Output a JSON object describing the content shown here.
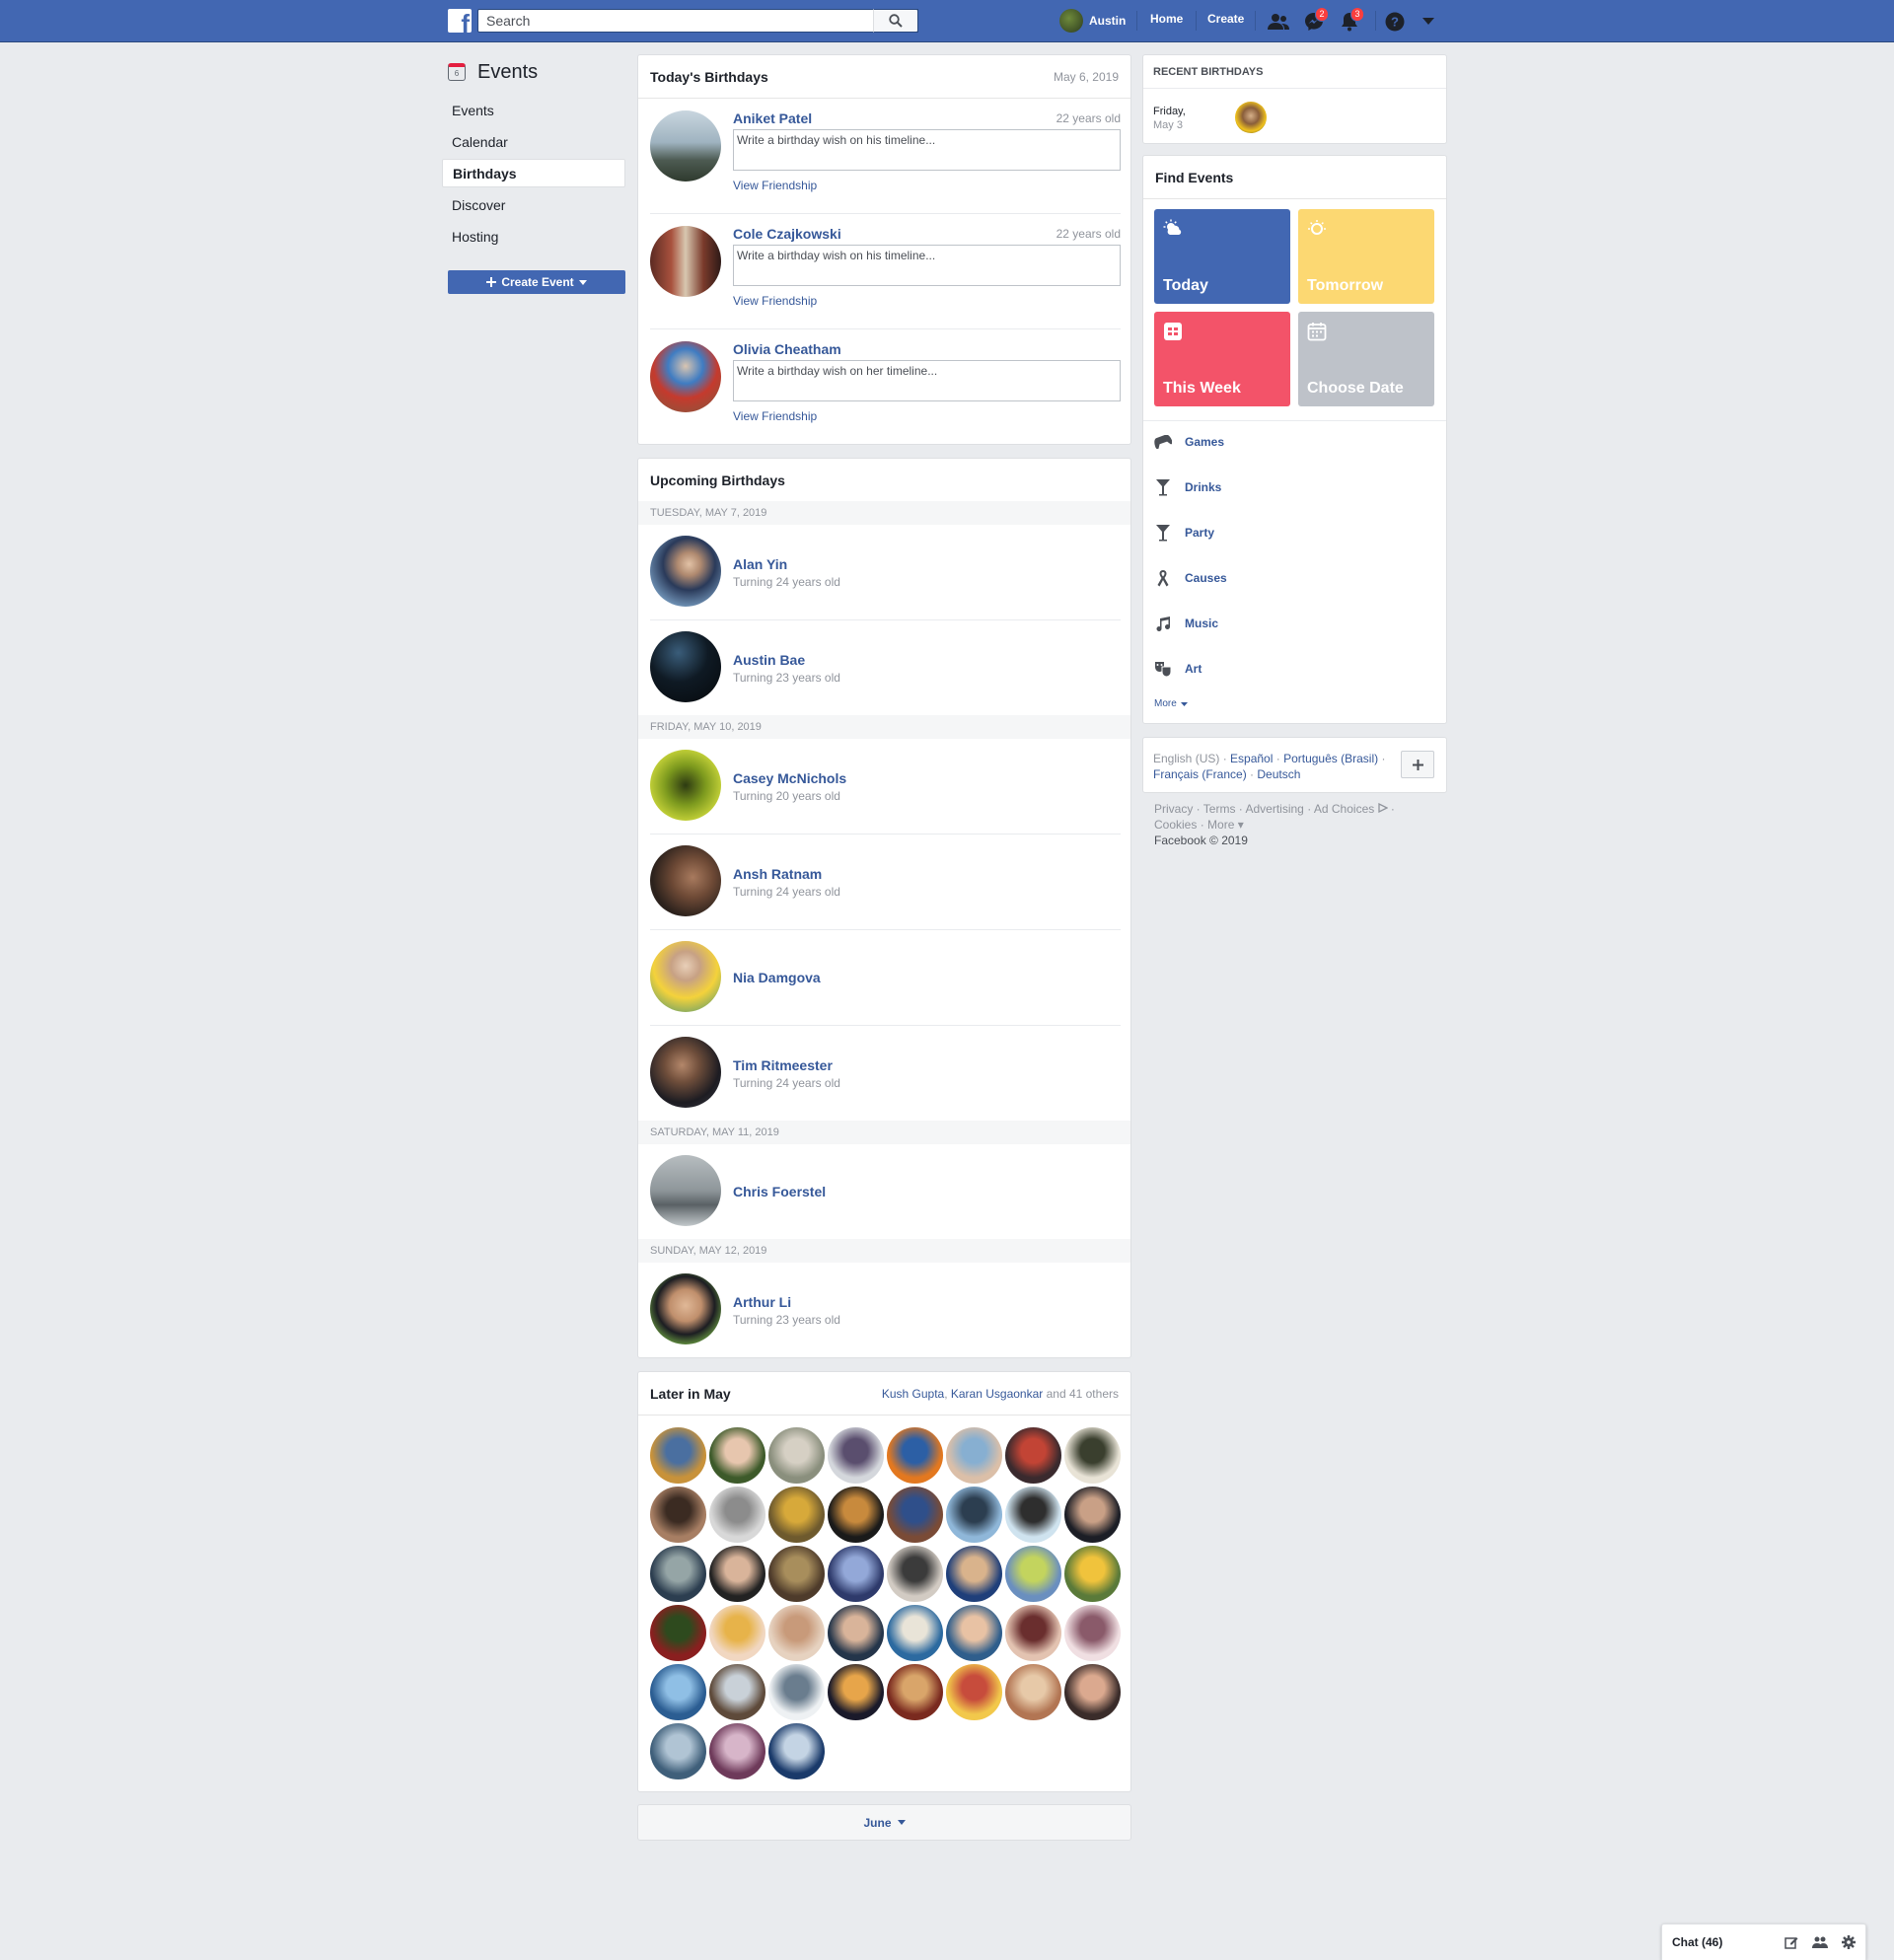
{
  "topbar": {
    "search_placeholder": "Search",
    "user_name": "Austin",
    "home_label": "Home",
    "create_label": "Create",
    "messages_badge": "2",
    "notifications_badge": "3",
    "brand_color": "#4267b2"
  },
  "leftnav": {
    "title": "Events",
    "cal_day": "6",
    "items": [
      {
        "label": "Events"
      },
      {
        "label": "Calendar"
      },
      {
        "label": "Birthdays"
      },
      {
        "label": "Discover"
      },
      {
        "label": "Hosting"
      }
    ],
    "create_button": "Create Event"
  },
  "today": {
    "title": "Today's Birthdays",
    "date": "May 6, 2019",
    "people": [
      {
        "name": "Aniket Patel",
        "age": "22 years old",
        "placeholder": "Write a birthday wish on his timeline...",
        "link": "View Friendship"
      },
      {
        "name": "Cole Czajkowski",
        "age": "22 years old",
        "placeholder": "Write a birthday wish on his timeline...",
        "link": "View Friendship"
      },
      {
        "name": "Olivia Cheatham",
        "age": "",
        "placeholder": "Write a birthday wish on her timeline...",
        "link": "View Friendship"
      }
    ]
  },
  "upcoming": {
    "title": "Upcoming Birthdays",
    "groups": [
      {
        "date": "TUESDAY, MAY 7, 2019"
      },
      {
        "date": "FRIDAY, MAY 10, 2019"
      },
      {
        "date": "SATURDAY, MAY 11, 2019"
      },
      {
        "date": "SUNDAY, MAY 12, 2019"
      }
    ],
    "people": [
      {
        "name": "Alan Yin",
        "sub": "Turning 24 years old"
      },
      {
        "name": "Austin Bae",
        "sub": "Turning 23 years old"
      },
      {
        "name": "Casey McNichols",
        "sub": "Turning 20 years old"
      },
      {
        "name": "Ansh Ratnam",
        "sub": "Turning 24 years old"
      },
      {
        "name": "Nia Damgova",
        "sub": ""
      },
      {
        "name": "Tim Ritmeester",
        "sub": "Turning 24 years old"
      },
      {
        "name": "Chris Foerstel",
        "sub": ""
      },
      {
        "name": "Arthur Li",
        "sub": "Turning 23 years old"
      }
    ]
  },
  "later": {
    "title": "Later in May",
    "names_1": "Kush Gupta",
    "sep": ", ",
    "names_2": "Karan Usgaonkar",
    "others": " and 41 others",
    "count": 43
  },
  "june_button": "June",
  "recent": {
    "title": "RECENT BIRTHDAYS",
    "day": "Friday,",
    "date": "May 3"
  },
  "find_events": {
    "title": "Find Events",
    "tiles": [
      {
        "label": "Today",
        "color": "#4267b2"
      },
      {
        "label": "Tomorrow",
        "color": "#fcd872"
      },
      {
        "label": "This Week",
        "color": "#f35369"
      },
      {
        "label": "Choose Date",
        "color": "#bec2c9"
      }
    ],
    "categories": [
      {
        "label": "Games",
        "icon": "gamepad-icon"
      },
      {
        "label": "Drinks",
        "icon": "cocktail-icon"
      },
      {
        "label": "Party",
        "icon": "cocktail-icon"
      },
      {
        "label": "Causes",
        "icon": "ribbon-icon"
      },
      {
        "label": "Music",
        "icon": "music-note-icon"
      },
      {
        "label": "Art",
        "icon": "theater-masks-icon"
      }
    ],
    "more": "More"
  },
  "languages": {
    "current": "English (US)",
    "l1": "Español",
    "l2": "Português (Brasil)",
    "l3": "Français (France)",
    "l4": "Deutsch",
    "dot": " · "
  },
  "footer": {
    "privacy": "Privacy",
    "terms": "Terms",
    "advertising": "Advertising",
    "adchoices": "Ad Choices",
    "cookies": "Cookies",
    "more": "More",
    "copyright": "Facebook © 2019"
  },
  "chat": {
    "label": "Chat (46)"
  }
}
